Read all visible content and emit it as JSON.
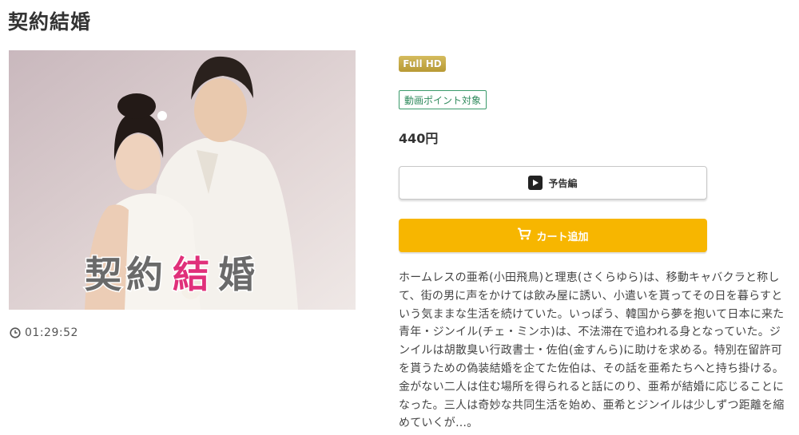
{
  "page": {
    "title": "契約結婚"
  },
  "thumbnail": {
    "overlay_title": "契約結婚",
    "overlay_parts": [
      "契約",
      "結",
      "婚"
    ]
  },
  "duration": {
    "icon": "clock-icon",
    "value": "01:29:52"
  },
  "badges": {
    "full_hd": "Full HD",
    "point": "動画ポイント対象"
  },
  "price": "440円",
  "buttons": {
    "trailer": {
      "label": "予告編",
      "icon": "play-icon"
    },
    "cart": {
      "label": "カート追加",
      "icon": "cart-icon"
    }
  },
  "description": "ホームレスの亜希(小田飛鳥)と理恵(さくらゆら)は、移動キャバクラと称して、街の男に声をかけては飲み屋に誘い、小遣いを貰ってその日を暮らすという気ままな生活を続けていた。いっぽう、韓国から夢を抱いて日本に来た青年・ジンイル(チェ・ミンホ)は、不法滞在で追われる身となっていた。ジンイルは胡散臭い行政書士・佐伯(金すんら)に助けを求める。特別在留許可を貰うための偽装結婚を企てた佐伯は、その話を亜希たちへと持ち掛ける。金がない二人は住む場所を得られると話にのり、亜希が結婚に応じることになった。三人は奇妙な共同生活を始め、亜希とジンイルは少しずつ距離を縮めていくが…。",
  "colors": {
    "accent_cart": "#f7b600",
    "badge_gold": "#c4a846",
    "badge_green": "#2f8a5c",
    "overlay_pink": "#e0307a"
  }
}
